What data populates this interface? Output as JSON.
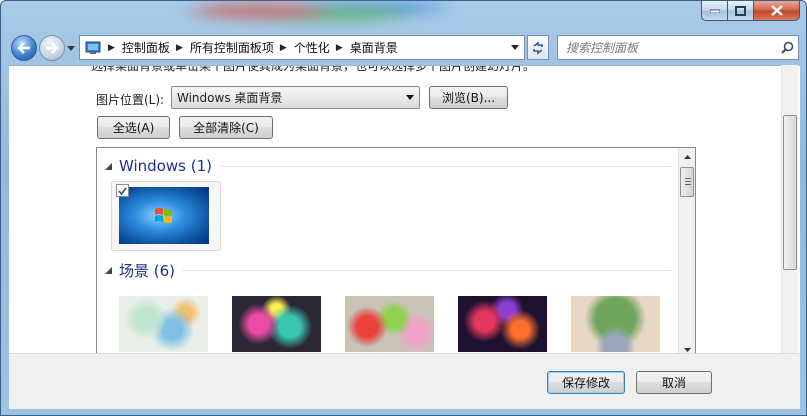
{
  "nav": {
    "breadcrumbs": [
      {
        "label": "控制面板"
      },
      {
        "label": "所有控制面板项"
      },
      {
        "label": "个性化"
      },
      {
        "label": "桌面背景"
      }
    ],
    "search_placeholder": "搜索控制面板"
  },
  "content": {
    "cut_text": "选择桌面背景或单击某个图片使其成为桌面背景，也可以选择多个图片创建幻灯片。",
    "location_label": "图片位置(L):",
    "location_value": "Windows 桌面背景",
    "browse_label": "浏览(B)...",
    "select_all_label": "全选(A)",
    "clear_all_label": "全部清除(C)",
    "groups": [
      {
        "title": "Windows (1)"
      },
      {
        "title": "场景 (6)"
      }
    ]
  },
  "footer": {
    "save_label": "保存修改",
    "cancel_label": "取消"
  },
  "colors": {
    "group_title": "#1e3287",
    "close_button": "#c2472b"
  }
}
